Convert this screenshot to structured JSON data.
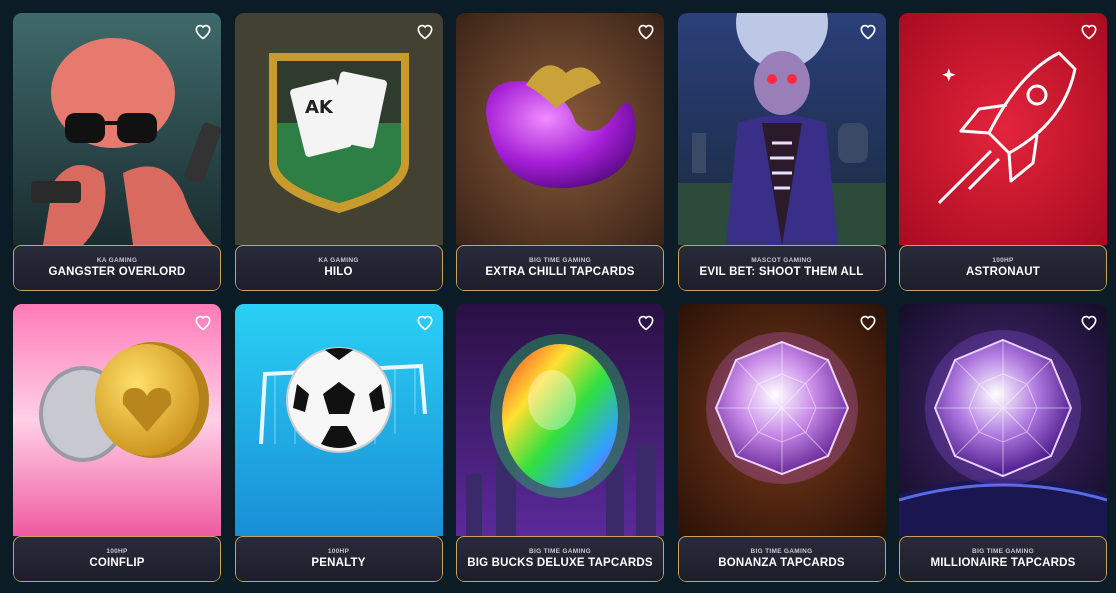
{
  "games": [
    {
      "provider": "KA GAMING",
      "title": "GANGSTER OVERLORD",
      "icon": "octopus-gangster-icon",
      "bg": "#2d4a4c"
    },
    {
      "provider": "KA GAMING",
      "title": "HILO",
      "icon": "cards-shield-icon",
      "bg": "#3c3a30"
    },
    {
      "provider": "BIG TIME GAMING",
      "title": "EXTRA CHILLI TAPCARDS",
      "icon": "purple-chilli-icon",
      "bg": "#6e3f2c"
    },
    {
      "provider": "MASCOT GAMING",
      "title": "EVIL BET: SHOOT THEM ALL",
      "icon": "zombie-icon",
      "bg": "#2c3a66"
    },
    {
      "provider": "100HP",
      "title": "ASTRONAUT",
      "icon": "rocket-icon",
      "bg": "#c3122a"
    },
    {
      "provider": "100HP",
      "title": "COINFLIP",
      "icon": "coin-icon",
      "bg": "#f06ea8"
    },
    {
      "provider": "100HP",
      "title": "PENALTY",
      "icon": "soccer-ball-icon",
      "bg": "#29b4e8"
    },
    {
      "provider": "BIG TIME GAMING",
      "title": "BIG BUCKS DELUXE TAPCARDS",
      "icon": "rainbow-gem-icon",
      "bg": "#3a1a66"
    },
    {
      "provider": "BIG TIME GAMING",
      "title": "BONANZA TAPCARDS",
      "icon": "diamond-icon",
      "bg": "#4a2516"
    },
    {
      "provider": "BIG TIME GAMING",
      "title": "MILLIONAIRE TAPCARDS",
      "icon": "diamond-icon",
      "bg": "#2a1a48"
    }
  ],
  "colors": {
    "page_bg": "#0b1c26",
    "caption_border": "#c9a45a",
    "heart": "#ffffff"
  }
}
